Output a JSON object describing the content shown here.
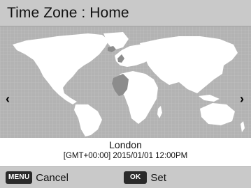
{
  "header": {
    "title": "Time Zone : Home"
  },
  "map": {
    "nav_left_icon": "chevron-left-icon",
    "nav_right_icon": "chevron-right-icon",
    "nav_left_glyph": "‹",
    "nav_right_glyph": "›",
    "colors": {
      "background": "#b3b3b3",
      "land": "#ffffff",
      "highlight": "#8c8c8c",
      "grid": "#c4c4c4"
    }
  },
  "info": {
    "city": "London",
    "details": "[GMT+00:00] 2015/01/01 12:00PM"
  },
  "footer": {
    "cancel": {
      "key": "MENU",
      "label": "Cancel"
    },
    "set": {
      "key": "OK",
      "label": "Set"
    }
  }
}
